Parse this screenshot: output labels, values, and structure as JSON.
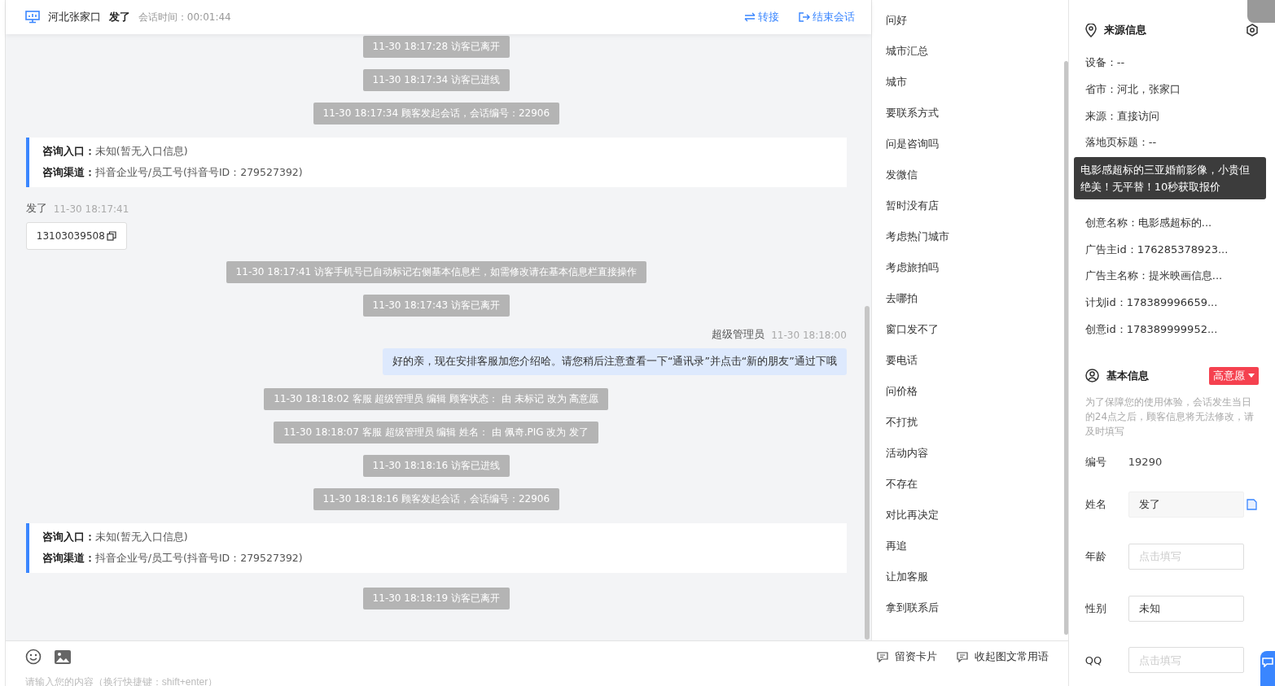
{
  "header": {
    "location": "河北张家口",
    "visitor": "发了",
    "session_label": "会话时间：",
    "session_time": "00:01:44",
    "actions": [
      {
        "kind": "transfer",
        "label": "转接"
      },
      {
        "kind": "end",
        "label": "结束会话"
      }
    ]
  },
  "messages": [
    {
      "kind": "system",
      "text": "11-30 18:17:28 访客已离开"
    },
    {
      "kind": "system",
      "text": "11-30 18:17:34 访客已进线"
    },
    {
      "kind": "system",
      "text": "11-30 18:17:34 顾客发起会话，会话编号：22906"
    },
    {
      "kind": "entry",
      "lines": [
        {
          "label": "咨询入口：",
          "value": "未知(暂无入口信息)"
        },
        {
          "label": "咨询渠道：",
          "value": "抖音企业号/员工号(抖音号ID：279527392)"
        }
      ]
    },
    {
      "kind": "visitor",
      "name": "发了",
      "time": "11-30 18:17:41",
      "text": "13103039508"
    },
    {
      "kind": "system",
      "text": "11-30 18:17:41 访客手机号已自动标记右侧基本信息栏，如需修改请在基本信息栏直接操作"
    },
    {
      "kind": "system",
      "text": "11-30 18:17:43 访客已离开"
    },
    {
      "kind": "agent",
      "name": "超级管理员",
      "time": "11-30 18:18:00",
      "text": "好的亲，现在安排客服加您介绍哈。请您稍后注意查看一下“通讯录”并点击“新的朋友”通过下哦"
    },
    {
      "kind": "system",
      "text": "11-30 18:18:02 客服 超级管理员 编辑 顾客状态： 由 未标记 改为 高意愿"
    },
    {
      "kind": "system",
      "text": "11-30 18:18:07 客服 超级管理员 编辑 姓名： 由 佩奇.PIG 改为 发了"
    },
    {
      "kind": "system",
      "text": "11-30 18:18:16 访客已进线"
    },
    {
      "kind": "system",
      "text": "11-30 18:18:16 顾客发起会话，会话编号：22906"
    },
    {
      "kind": "entry",
      "lines": [
        {
          "label": "咨询入口：",
          "value": "未知(暂无入口信息)"
        },
        {
          "label": "咨询渠道：",
          "value": "抖音企业号/员工号(抖音号ID：279527392)"
        }
      ]
    },
    {
      "kind": "system",
      "text": "11-30 18:18:19 访客已离开"
    }
  ],
  "composer": {
    "placeholder": "请输入您的内容（换行快捷键：shift+enter）",
    "actions": [
      "留资卡片",
      "收起图文常用语"
    ]
  },
  "quick_phrases": [
    "问好",
    "城市汇总",
    "城市",
    "要联系方式",
    "问是咨询吗",
    "发微信",
    "暂时没有店",
    "考虑热门城市",
    "考虑旅拍吗",
    "去哪拍",
    "窗口发不了",
    "要电话",
    "问价格",
    "不打扰",
    "活动内容",
    "不存在",
    "对比再决定",
    "再追",
    "让加客服",
    "拿到联系后"
  ],
  "source_info": {
    "title": "来源信息",
    "rows": [
      "设备：--",
      "省市：河北，张家口",
      "来源：直接访问",
      "落地页标题：--"
    ],
    "tooltip": "电影感超标的三亚婚前影像，小贵但绝美！无平替！10秒获取报价",
    "rows_after": [
      "创意名称：电影感超标的...",
      "广告主id：176285378923...",
      "广告主名称：提米映画信息...",
      "计划id：178389996659...",
      "创意id：178389999952..."
    ]
  },
  "basic_info": {
    "title": "基本信息",
    "status": "高意愿",
    "notice": "为了保障您的使用体验，会话发生当日的24点之后，顾客信息将无法修改，请及时填写",
    "fields": [
      {
        "kind": "text",
        "label": "编号",
        "value": "19290"
      },
      {
        "kind": "filled",
        "label": "姓名",
        "value": "发了"
      },
      {
        "kind": "input",
        "label": "年龄",
        "placeholder": "点击填写"
      },
      {
        "kind": "input",
        "label": "性别",
        "value": "未知"
      },
      {
        "kind": "input",
        "label": "QQ",
        "placeholder": "点击填写"
      }
    ]
  }
}
